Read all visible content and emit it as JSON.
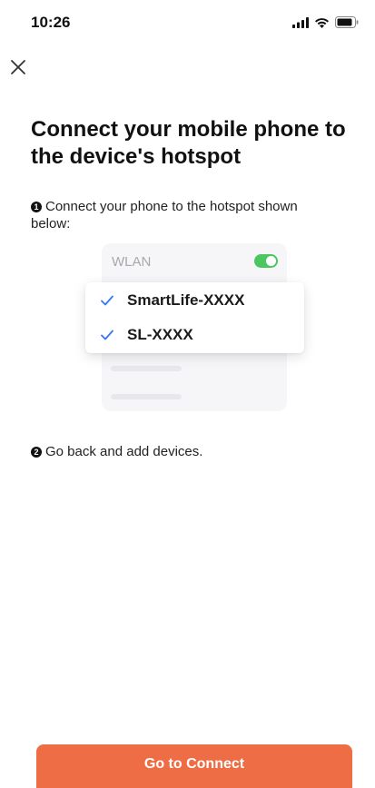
{
  "status_bar": {
    "time": "10:26",
    "icons": [
      "signal-icon",
      "wifi-icon",
      "battery-icon"
    ]
  },
  "close_icon": "close-icon",
  "title": "Connect your mobile phone to the device's hotspot",
  "steps": [
    {
      "number": "1",
      "text": "Connect your phone to the hotspot shown below:"
    },
    {
      "number": "2",
      "text": "Go back and add devices."
    }
  ],
  "illustration": {
    "wlan_label": "WLAN",
    "wlan_enabled": true,
    "networks": [
      {
        "name": "SmartLife-XXXX",
        "checked": true
      },
      {
        "name": "SL-XXXX",
        "checked": true
      }
    ]
  },
  "primary_button": {
    "label": "Go to Connect"
  },
  "colors": {
    "accent": "#ee6d44",
    "check": "#3478f6",
    "toggle_on": "#4cc760"
  }
}
